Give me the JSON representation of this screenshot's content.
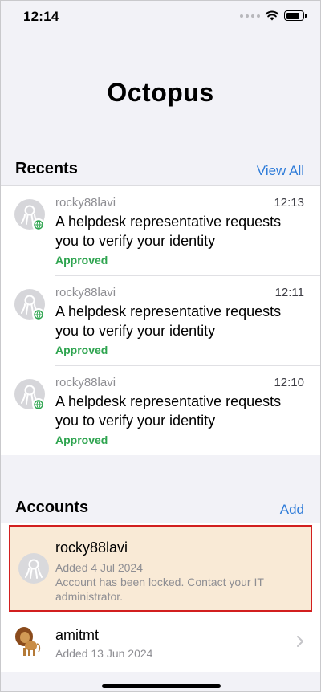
{
  "status": {
    "time": "12:14"
  },
  "app": {
    "title": "Octopus"
  },
  "recents": {
    "title": "Recents",
    "view_all": "View All",
    "items": [
      {
        "user": "rocky88lavi",
        "time": "12:13",
        "message": "A helpdesk representative requests you to verify your identity",
        "status": "Approved"
      },
      {
        "user": "rocky88lavi",
        "time": "12:11",
        "message": "A helpdesk representative requests you to verify your identity",
        "status": "Approved"
      },
      {
        "user": "rocky88lavi",
        "time": "12:10",
        "message": "A helpdesk representative requests you to verify your identity",
        "status": "Approved"
      }
    ]
  },
  "accounts": {
    "title": "Accounts",
    "add": "Add",
    "items": [
      {
        "name": "rocky88lavi",
        "added": "Added 4 Jul 2024",
        "note": "Account has been locked. Contact your IT administrator.",
        "icon": "octopus-avatar-icon"
      },
      {
        "name": "amitmt",
        "added": "Added 13 Jun 2024",
        "icon": "lion-avatar-icon"
      }
    ]
  },
  "colors": {
    "accent": "#2f7cd9",
    "approved": "#2ea44f",
    "locked_bg": "#f9ead6",
    "highlight_border": "#d21f1f"
  }
}
